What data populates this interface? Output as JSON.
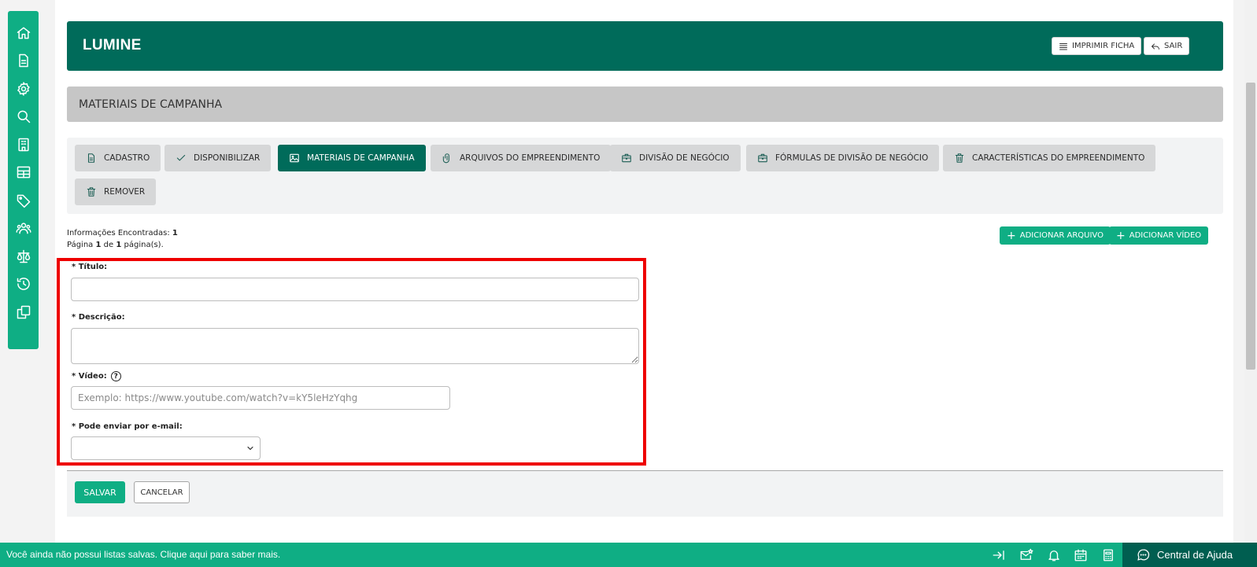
{
  "header": {
    "brand": "LUMINE",
    "print_label": "IMPRIMIR FICHA",
    "exit_label": "SAIR"
  },
  "section": {
    "title": "MATERIAIS DE CAMPANHA"
  },
  "tabs": [
    {
      "label": "CADASTRO",
      "icon": "document-icon",
      "active": false
    },
    {
      "label": "DISPONIBILIZAR",
      "icon": "check-icon",
      "active": false
    },
    {
      "label": "MATERIAIS DE CAMPANHA",
      "icon": "image-icon",
      "active": true
    },
    {
      "label": "ARQUIVOS DO EMPREENDIMENTO",
      "icon": "paperclip-icon",
      "active": false
    },
    {
      "label": "DIVISÃO DE NEGÓCIO",
      "icon": "briefcase-icon",
      "active": false
    },
    {
      "label": "FÓRMULAS DE DIVISÃO DE NEGÓCIO",
      "icon": "briefcase-icon",
      "active": false
    },
    {
      "label": "CARACTERÍSTICAS DO EMPREENDIMENTO",
      "icon": "trash-icon",
      "active": false
    },
    {
      "label": "REMOVER",
      "icon": "trash-icon",
      "active": false
    }
  ],
  "info": {
    "found_label": "Informações Encontradas:",
    "found_count": "1",
    "page_prefix": "Página",
    "page_current": "1",
    "page_of": "de",
    "page_total": "1",
    "page_suffix": "página(s)."
  },
  "buttons": {
    "add_file": "ADICIONAR ARQUIVO",
    "add_video": "ADICIONAR VÍDEO",
    "save": "SALVAR",
    "cancel": "CANCELAR"
  },
  "form": {
    "title_label": "* Título:",
    "title_value": "",
    "description_label": "* Descrição:",
    "description_value": "",
    "video_label": "* Vídeo:",
    "video_help": "?",
    "video_placeholder": "Exemplo: https://www.youtube.com/watch?v=kY5leHzYqhg",
    "email_label": "* Pode enviar por e-mail:",
    "email_value": ""
  },
  "sidebar": {
    "items": [
      "home-icon",
      "file-icon",
      "settings-icon",
      "search-icon",
      "building-icon",
      "table-icon",
      "tag-icon",
      "users-icon",
      "scale-icon",
      "history-icon",
      "copy-icon"
    ]
  },
  "bottombar": {
    "message": "Você ainda não possui listas salvas. Clique aqui para saber mais.",
    "help_center": "Central de Ajuda"
  },
  "colors": {
    "brand_dark": "#006b5a",
    "accent": "#0fae84",
    "highlight": "#ee0000",
    "section_gray": "#c6c6c6"
  }
}
